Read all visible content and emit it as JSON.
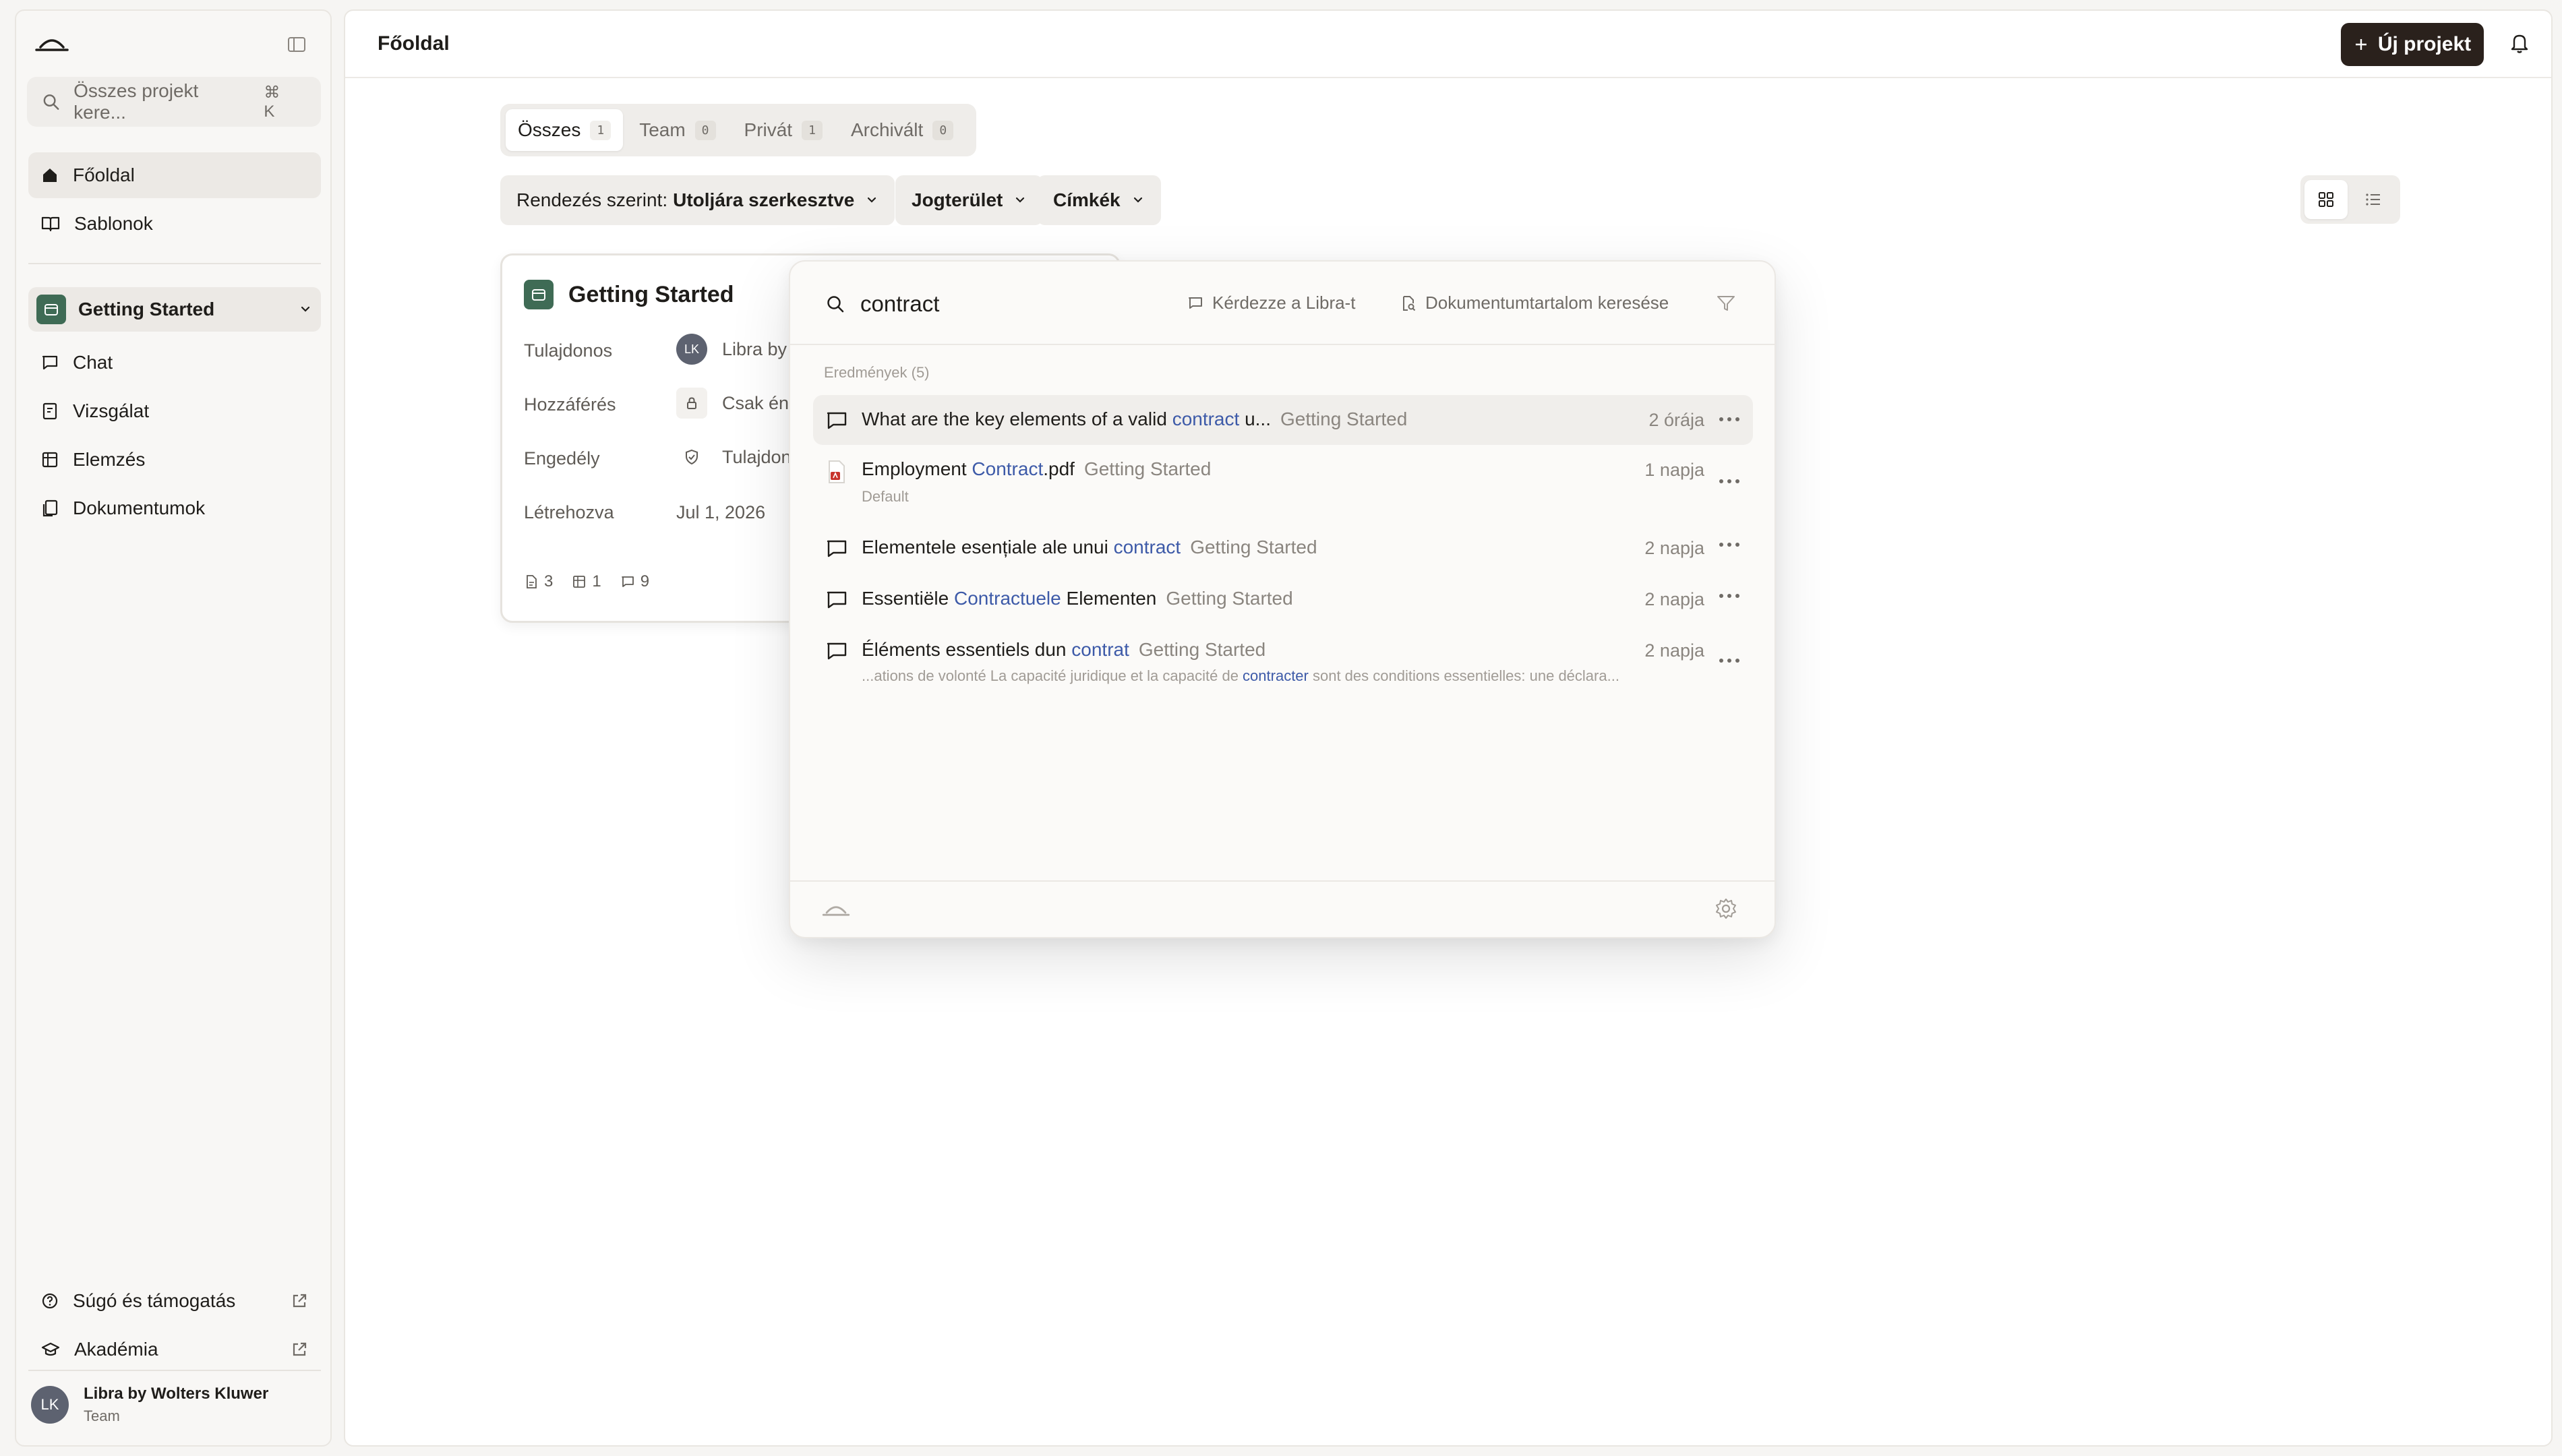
{
  "sidebar": {
    "search_placeholder": "Összes projekt kere...",
    "search_shortcut": "⌘ K",
    "nav": [
      {
        "label": "Főoldal",
        "icon": "home-icon"
      },
      {
        "label": "Sablonok",
        "icon": "book-icon"
      }
    ],
    "project": {
      "label": "Getting Started"
    },
    "project_nav": [
      {
        "label": "Chat",
        "icon": "chat-icon"
      },
      {
        "label": "Vizsgálat",
        "icon": "review-icon"
      },
      {
        "label": "Elemzés",
        "icon": "table-icon"
      },
      {
        "label": "Dokumentumok",
        "icon": "documents-icon"
      }
    ],
    "footer_links": [
      {
        "label": "Súgó és támogatás",
        "icon": "help-icon"
      },
      {
        "label": "Akadémia",
        "icon": "academy-icon"
      }
    ],
    "user": {
      "initials": "LK",
      "name": "Libra by Wolters Kluwer",
      "team": "Team"
    }
  },
  "header": {
    "title": "Főoldal",
    "new_project_label": "Új projekt"
  },
  "tabs": [
    {
      "label": "Összes",
      "count": "1",
      "active": true
    },
    {
      "label": "Team",
      "count": "0",
      "active": false
    },
    {
      "label": "Privát",
      "count": "1",
      "active": false
    },
    {
      "label": "Archivált",
      "count": "0",
      "active": false
    }
  ],
  "filters": {
    "sort_prefix": "Rendezés szerint:",
    "sort_value": "Utoljára szerkesztve",
    "jurisdiction": "Jogterület",
    "tags": "Címkék"
  },
  "card": {
    "title": "Getting Started",
    "rows": [
      {
        "label": "Tulajdonos",
        "value": "Libra by",
        "initials": "LK"
      },
      {
        "label": "Hozzáférés",
        "value": "Csak én"
      },
      {
        "label": "Engedély",
        "value": "Tulajdon"
      },
      {
        "label": "Létrehozva",
        "value": "Jul 1, 2026"
      }
    ],
    "stats": {
      "documents": "3",
      "tables": "1",
      "chats": "9"
    }
  },
  "search": {
    "query": "contract",
    "ask_action": "Kérdezze a Libra-t",
    "content_search_action": "Dokumentumtartalom keresése",
    "results_label": "Eredmények (5)",
    "results": [
      {
        "pre": "What are the key elements of a valid ",
        "hit": "contract",
        "post": " u...",
        "project": "Getting Started",
        "time": "2 órája",
        "icon": "chat-icon",
        "sub": null
      },
      {
        "pre": "Employment ",
        "hit": "Contract",
        "post": ".pdf",
        "project": "Getting Started",
        "time": "1 napja",
        "icon": "pdf-icon",
        "sub": {
          "pre": "Default",
          "hit": "",
          "post": ""
        }
      },
      {
        "pre": "Elementele esențiale ale unui ",
        "hit": "contract",
        "post": "",
        "project": "Getting Started",
        "time": "2 napja",
        "icon": "chat-icon",
        "sub": null
      },
      {
        "pre": "Essentiële ",
        "hit": "Contractuele",
        "post": " Elementen",
        "project": "Getting Started",
        "time": "2 napja",
        "icon": "chat-icon",
        "sub": null
      },
      {
        "pre": "Éléments essentiels dun ",
        "hit": "contrat",
        "post": "",
        "project": "Getting Started",
        "time": "2 napja",
        "icon": "chat-icon",
        "sub": {
          "pre": "...ations de volonté La capacité juridique et la capacité de ",
          "hit": "contracter",
          "post": " sont des conditions essentielles: une déclara..."
        }
      }
    ]
  },
  "colors": {
    "accent_dark": "#2a211c",
    "project_green": "#3f6b55",
    "highlight_blue": "#3d5aa8"
  }
}
